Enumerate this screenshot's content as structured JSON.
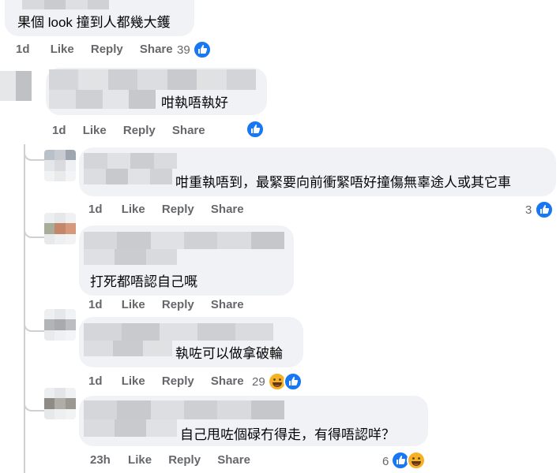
{
  "comments": [
    {
      "text": "果個 look 撞到人都幾大鑊",
      "time": "1d",
      "like": "Like",
      "reply": "Reply",
      "share": "Share",
      "reactions": "39",
      "reaction_icons": [
        "like-icon"
      ]
    },
    {
      "text": "咁執唔執好",
      "time": "1d",
      "like": "Like",
      "reply": "Reply",
      "share": "Share",
      "reactions": "",
      "reaction_icons": [
        "like-icon"
      ]
    },
    {
      "text": "咁重執唔到，最緊要向前衝緊唔好撞傷無辜途人或其它車",
      "time": "1d",
      "like": "Like",
      "reply": "Reply",
      "share": "Share",
      "reactions": "3",
      "reaction_icons": [
        "like-icon"
      ]
    },
    {
      "text": "打死都唔認自己嘅",
      "time": "1d",
      "like": "Like",
      "reply": "Reply",
      "share": "Share",
      "reactions": "",
      "reaction_icons": []
    },
    {
      "text": "執咗可以做拿破輪",
      "time": "1d",
      "like": "Like",
      "reply": "Reply",
      "share": "Share",
      "reactions": "29",
      "reaction_icons": [
        "haha-icon",
        "like-icon"
      ]
    },
    {
      "text": "自己甩咗個碌冇得走，有得唔認咩？",
      "time": "23h",
      "like": "Like",
      "reply": "Reply",
      "share": "Share",
      "reactions": "6",
      "reaction_icons": [
        "like-icon",
        "haha-icon"
      ]
    }
  ],
  "colors": {
    "bubble": "#f0f2f5",
    "meta": "#65676b",
    "like_blue": "#1877f2",
    "haha_yellow": "#f7b125",
    "thread_line": "#ced0d4"
  }
}
